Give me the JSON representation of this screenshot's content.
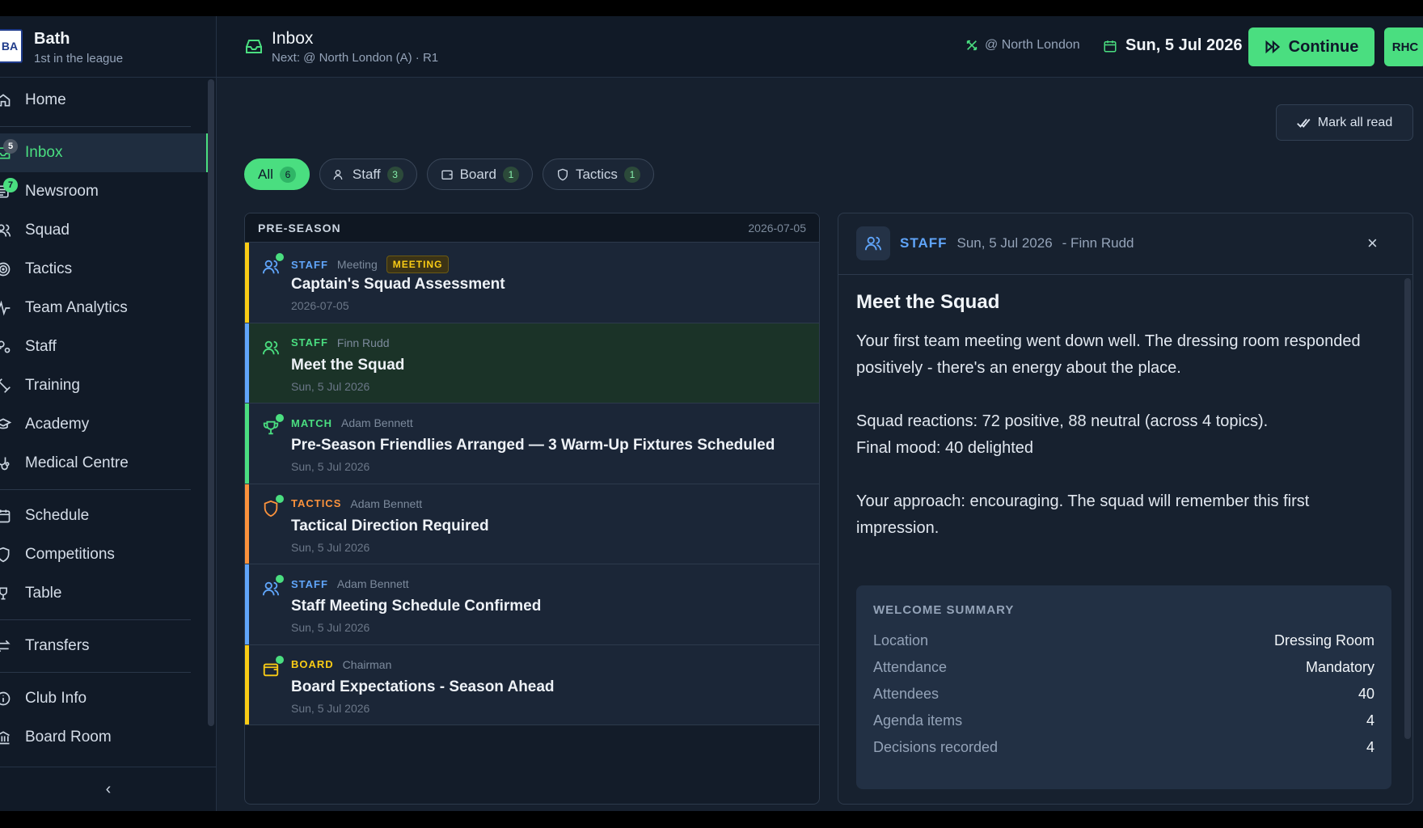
{
  "club": {
    "logo_text": "BA",
    "name": "Bath",
    "position": "1st in the league"
  },
  "nav": {
    "home": "Home",
    "inbox": "Inbox",
    "inbox_badge": "5",
    "newsroom": "Newsroom",
    "newsroom_badge": "7",
    "squad": "Squad",
    "tactics": "Tactics",
    "team_analytics": "Team Analytics",
    "staff": "Staff",
    "training": "Training",
    "academy": "Academy",
    "medical": "Medical Centre",
    "schedule": "Schedule",
    "competitions": "Competitions",
    "table": "Table",
    "transfers": "Transfers",
    "club_info": "Club Info",
    "board_room": "Board Room",
    "collapse": "‹"
  },
  "header": {
    "title": "Inbox",
    "subtitle": "Next: @ North London (A) · R1",
    "venue": "@ North London",
    "date": "Sun, 5 Jul 2026",
    "continue_label": "Continue",
    "avatar": "RHC"
  },
  "mark_all_read": "Mark all read",
  "filters": [
    {
      "label": "All",
      "count": "6"
    },
    {
      "label": "Staff",
      "count": "3"
    },
    {
      "label": "Board",
      "count": "1"
    },
    {
      "label": "Tactics",
      "count": "1"
    }
  ],
  "list": {
    "section": "PRE-SEASON",
    "section_date": "2026-07-05",
    "messages": [
      {
        "category": "STAFF",
        "from": "Meeting",
        "tag": "MEETING",
        "subject": "Captain's Squad Assessment",
        "date": "2026-07-05",
        "unread": true
      },
      {
        "category": "STAFF",
        "from": "Finn Rudd",
        "tag": "",
        "subject": "Meet the Squad",
        "date": "Sun, 5 Jul 2026",
        "unread": false
      },
      {
        "category": "MATCH",
        "from": "Adam Bennett",
        "tag": "",
        "subject": "Pre-Season Friendlies Arranged — 3 Warm-Up Fixtures Scheduled",
        "date": "Sun, 5 Jul 2026",
        "unread": true
      },
      {
        "category": "TACTICS",
        "from": "Adam Bennett",
        "tag": "",
        "subject": "Tactical Direction Required",
        "date": "Sun, 5 Jul 2026",
        "unread": true
      },
      {
        "category": "STAFF",
        "from": "Adam Bennett",
        "tag": "",
        "subject": "Staff Meeting Schedule Confirmed",
        "date": "Sun, 5 Jul 2026",
        "unread": true
      },
      {
        "category": "BOARD",
        "from": "Chairman",
        "tag": "",
        "subject": "Board Expectations - Season Ahead",
        "date": "Sun, 5 Jul 2026",
        "unread": true
      }
    ]
  },
  "detail": {
    "category": "STAFF",
    "date": "Sun, 5 Jul 2026",
    "from": "- Finn Rudd",
    "close": "×",
    "title": "Meet the Squad",
    "para1": "Your first team meeting went down well. The dressing room responded positively - there's an energy about the place.",
    "para2": "Squad reactions: 72 positive, 88 neutral (across 4 topics).\nFinal mood: 40 delighted",
    "para3": "Your approach: encouraging. The squad will remember this first impression.",
    "summary": {
      "title": "WELCOME SUMMARY",
      "rows": [
        {
          "k": "Location",
          "v": "Dressing Room"
        },
        {
          "k": "Attendance",
          "v": "Mandatory"
        },
        {
          "k": "Attendees",
          "v": "40"
        },
        {
          "k": "Agenda items",
          "v": "4"
        },
        {
          "k": "Decisions recorded",
          "v": "4"
        }
      ]
    }
  },
  "colors": {
    "accent": "#4ade80",
    "staff": "#60a5fa",
    "match": "#4ade80",
    "tactics": "#fb923c",
    "board": "#facc15"
  }
}
